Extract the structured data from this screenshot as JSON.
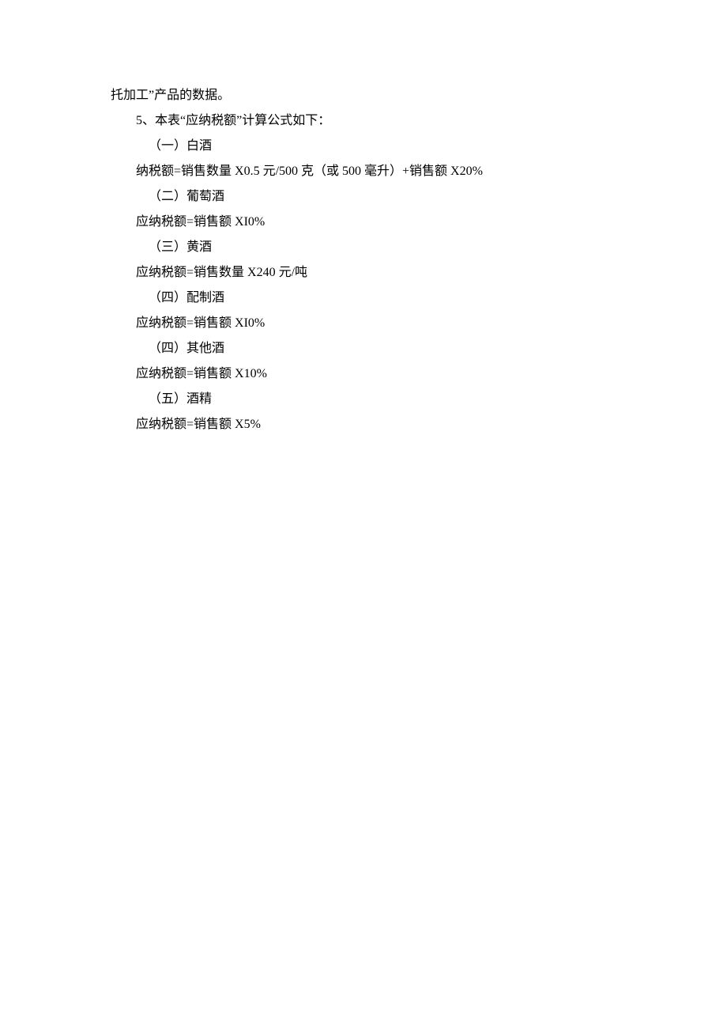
{
  "lines": {
    "l1": "托加工”产品的数据。",
    "l2": "5、本表“应纳税额”计算公式如下：",
    "l3": "（一）白酒",
    "l4": "纳税额=销售数量 X0.5 元/500 克（或 500 毫升）+销售额 X20%",
    "l5": "（二）葡萄酒",
    "l6": "应纳税额=销售额 XI0%",
    "l7": "（三）黄酒",
    "l8": "应纳税额=销售数量 X240 元/吨",
    "l9": "（四）配制酒",
    "l10": "应纳税额=销售额 XI0%",
    "l11": "（四）其他酒",
    "l12": "应纳税额=销售额 X10%",
    "l13": "（五）酒精",
    "l14": "应纳税额=销售额 X5%"
  }
}
